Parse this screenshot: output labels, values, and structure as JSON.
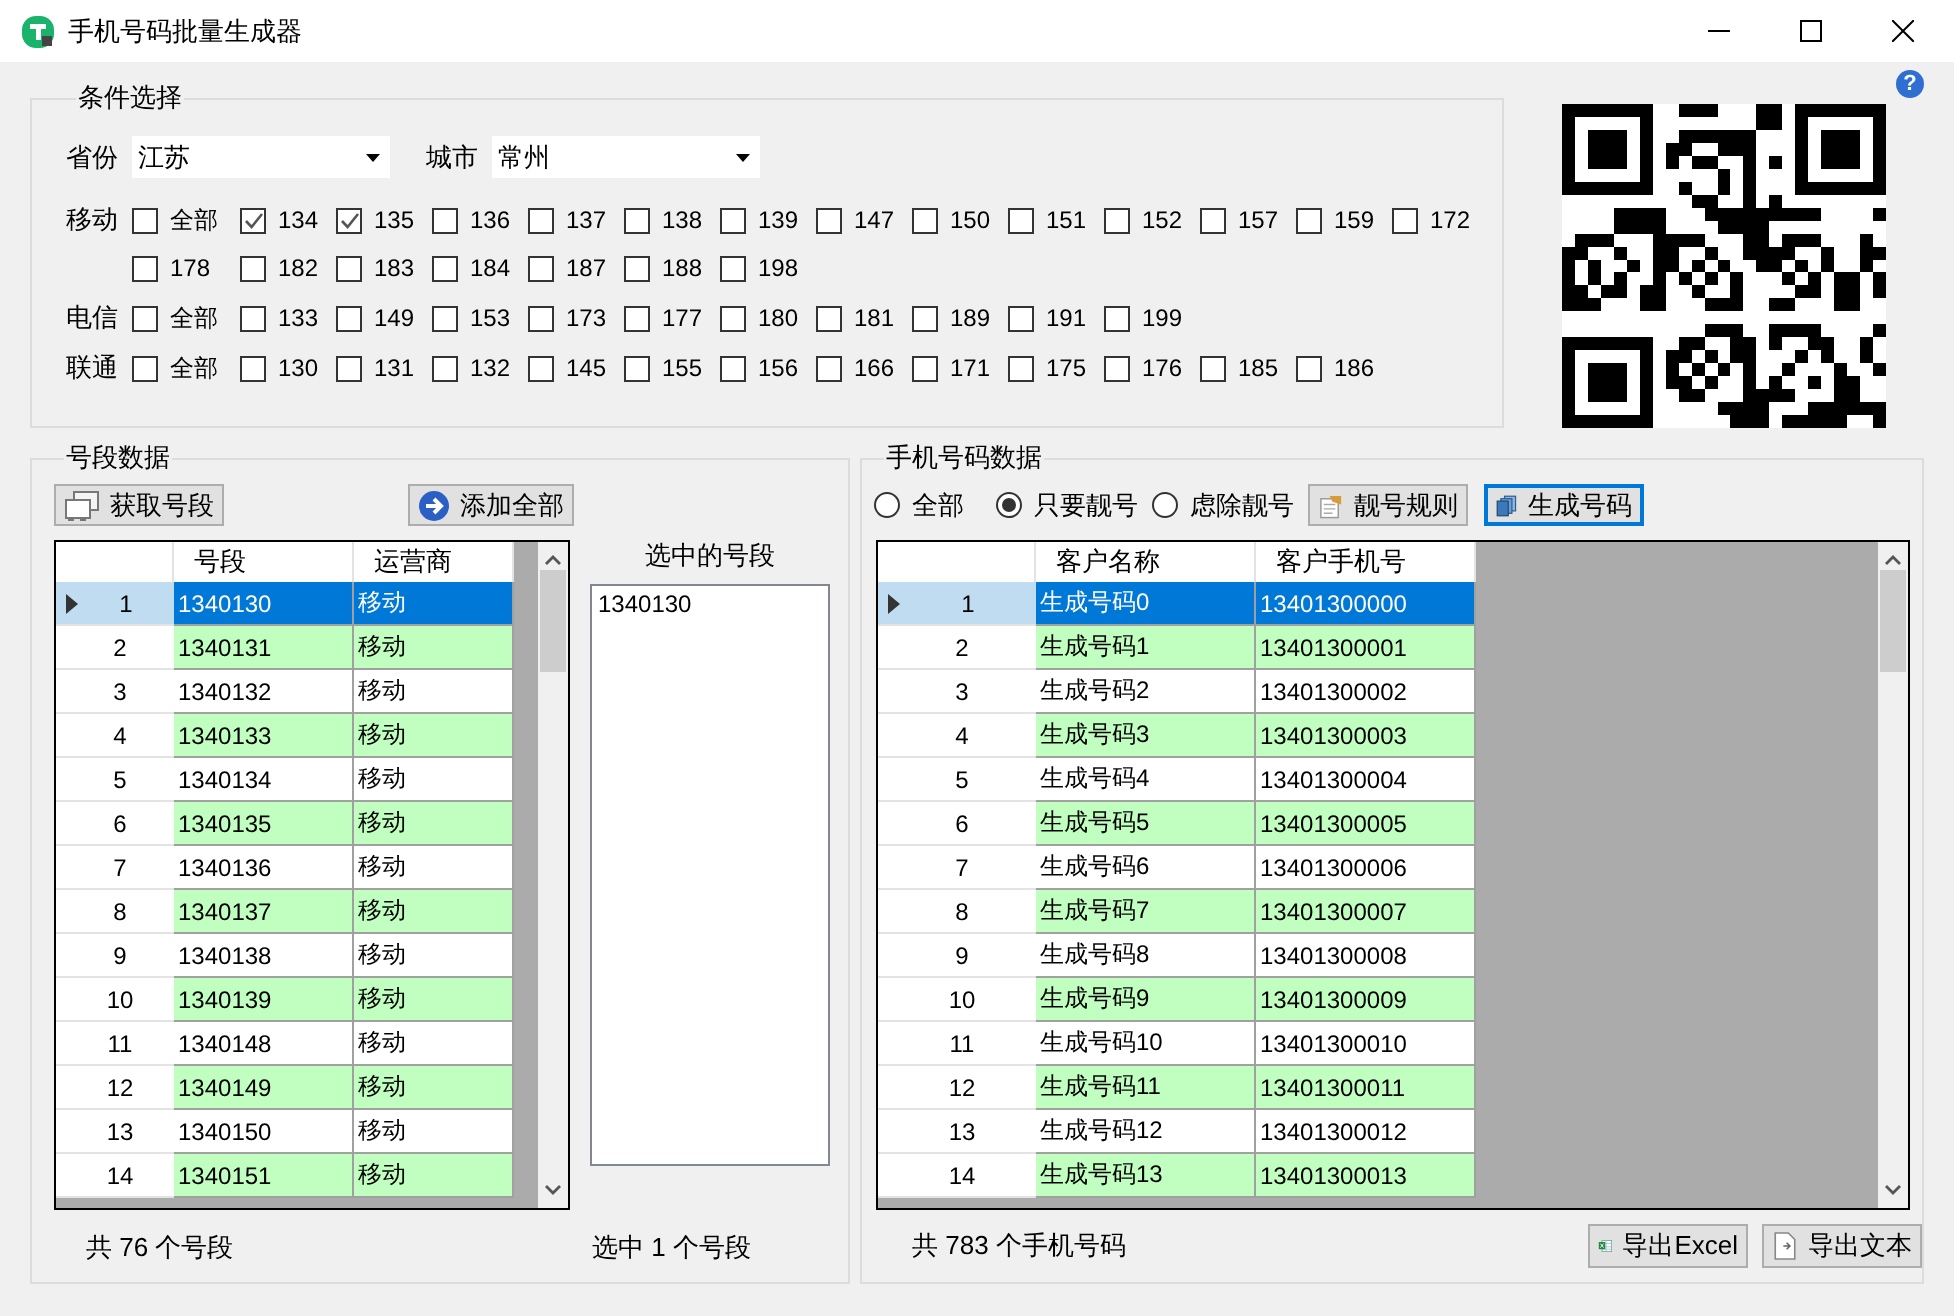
{
  "window": {
    "title": "手机号码批量生成器"
  },
  "help": {
    "label": "?"
  },
  "conditions": {
    "title": "条件选择",
    "province": {
      "label": "省份",
      "value": "江苏"
    },
    "city": {
      "label": "城市",
      "value": "常州"
    },
    "carriers": [
      {
        "name": "移动",
        "rows": [
          [
            {
              "label": "全部",
              "checked": false
            },
            {
              "label": "134",
              "checked": true
            },
            {
              "label": "135",
              "checked": true
            },
            {
              "label": "136",
              "checked": false
            },
            {
              "label": "137",
              "checked": false
            },
            {
              "label": "138",
              "checked": false
            },
            {
              "label": "139",
              "checked": false
            },
            {
              "label": "147",
              "checked": false
            },
            {
              "label": "150",
              "checked": false
            },
            {
              "label": "151",
              "checked": false
            },
            {
              "label": "152",
              "checked": false
            },
            {
              "label": "157",
              "checked": false
            },
            {
              "label": "159",
              "checked": false
            },
            {
              "label": "172",
              "checked": false
            }
          ],
          [
            {
              "label": "178",
              "checked": false
            },
            {
              "label": "182",
              "checked": false
            },
            {
              "label": "183",
              "checked": false
            },
            {
              "label": "184",
              "checked": false
            },
            {
              "label": "187",
              "checked": false
            },
            {
              "label": "188",
              "checked": false
            },
            {
              "label": "198",
              "checked": false
            }
          ]
        ]
      },
      {
        "name": "电信",
        "rows": [
          [
            {
              "label": "全部",
              "checked": false
            },
            {
              "label": "133",
              "checked": false
            },
            {
              "label": "149",
              "checked": false
            },
            {
              "label": "153",
              "checked": false
            },
            {
              "label": "173",
              "checked": false
            },
            {
              "label": "177",
              "checked": false
            },
            {
              "label": "180",
              "checked": false
            },
            {
              "label": "181",
              "checked": false
            },
            {
              "label": "189",
              "checked": false
            },
            {
              "label": "191",
              "checked": false
            },
            {
              "label": "199",
              "checked": false
            }
          ]
        ]
      },
      {
        "name": "联通",
        "rows": [
          [
            {
              "label": "全部",
              "checked": false
            },
            {
              "label": "130",
              "checked": false
            },
            {
              "label": "131",
              "checked": false
            },
            {
              "label": "132",
              "checked": false
            },
            {
              "label": "145",
              "checked": false
            },
            {
              "label": "155",
              "checked": false
            },
            {
              "label": "156",
              "checked": false
            },
            {
              "label": "166",
              "checked": false
            },
            {
              "label": "171",
              "checked": false
            },
            {
              "label": "175",
              "checked": false
            },
            {
              "label": "176",
              "checked": false
            },
            {
              "label": "185",
              "checked": false
            },
            {
              "label": "186",
              "checked": false
            }
          ]
        ]
      }
    ]
  },
  "ranges": {
    "title": "号段数据",
    "buttons": [
      {
        "label": "获取号段",
        "kind": "fetch"
      },
      {
        "label": "添加全部",
        "kind": "add"
      }
    ],
    "table": {
      "columns": [
        "号段",
        "运营商"
      ],
      "rows": [
        {
          "no": "1",
          "cells": [
            "1340130",
            "移动"
          ],
          "selected": true
        },
        {
          "no": "2",
          "cells": [
            "1340131",
            "移动"
          ],
          "selected": false
        },
        {
          "no": "3",
          "cells": [
            "1340132",
            "移动"
          ],
          "selected": false
        },
        {
          "no": "4",
          "cells": [
            "1340133",
            "移动"
          ],
          "selected": false
        },
        {
          "no": "5",
          "cells": [
            "1340134",
            "移动"
          ],
          "selected": false
        },
        {
          "no": "6",
          "cells": [
            "1340135",
            "移动"
          ],
          "selected": false
        },
        {
          "no": "7",
          "cells": [
            "1340136",
            "移动"
          ],
          "selected": false
        },
        {
          "no": "8",
          "cells": [
            "1340137",
            "移动"
          ],
          "selected": false
        },
        {
          "no": "9",
          "cells": [
            "1340138",
            "移动"
          ],
          "selected": false
        },
        {
          "no": "10",
          "cells": [
            "1340139",
            "移动"
          ],
          "selected": false
        },
        {
          "no": "11",
          "cells": [
            "1340148",
            "移动"
          ],
          "selected": false
        },
        {
          "no": "12",
          "cells": [
            "1340149",
            "移动"
          ],
          "selected": false
        },
        {
          "no": "13",
          "cells": [
            "1340150",
            "移动"
          ],
          "selected": false
        },
        {
          "no": "14",
          "cells": [
            "1340151",
            "移动"
          ],
          "selected": false
        }
      ]
    },
    "selected_title": "选中的号段",
    "selected_list": [
      "1340130"
    ],
    "total": "共 76 个号段",
    "selected_count": "选中 1 个号段"
  },
  "numbers": {
    "title": "手机号码数据",
    "filters": [
      {
        "label": "全部",
        "selected": false
      },
      {
        "label": "只要靓号",
        "selected": true
      },
      {
        "label": "虑除靓号",
        "selected": false
      }
    ],
    "buttons": [
      {
        "label": "靓号规则",
        "kind": "rules",
        "focused": false
      },
      {
        "label": "生成号码",
        "kind": "generate",
        "focused": true
      }
    ],
    "table": {
      "columns": [
        "客户名称",
        "客户手机号"
      ],
      "rows": [
        {
          "no": "1",
          "cells": [
            "生成号码0",
            "13401300000"
          ],
          "selected": true
        },
        {
          "no": "2",
          "cells": [
            "生成号码1",
            "13401300001"
          ],
          "selected": false
        },
        {
          "no": "3",
          "cells": [
            "生成号码2",
            "13401300002"
          ],
          "selected": false
        },
        {
          "no": "4",
          "cells": [
            "生成号码3",
            "13401300003"
          ],
          "selected": false
        },
        {
          "no": "5",
          "cells": [
            "生成号码4",
            "13401300004"
          ],
          "selected": false
        },
        {
          "no": "6",
          "cells": [
            "生成号码5",
            "13401300005"
          ],
          "selected": false
        },
        {
          "no": "7",
          "cells": [
            "生成号码6",
            "13401300006"
          ],
          "selected": false
        },
        {
          "no": "8",
          "cells": [
            "生成号码7",
            "13401300007"
          ],
          "selected": false
        },
        {
          "no": "9",
          "cells": [
            "生成号码8",
            "13401300008"
          ],
          "selected": false
        },
        {
          "no": "10",
          "cells": [
            "生成号码9",
            "13401300009"
          ],
          "selected": false
        },
        {
          "no": "11",
          "cells": [
            "生成号码10",
            "13401300010"
          ],
          "selected": false
        },
        {
          "no": "12",
          "cells": [
            "生成号码11",
            "13401300011"
          ],
          "selected": false
        },
        {
          "no": "13",
          "cells": [
            "生成号码12",
            "13401300012"
          ],
          "selected": false
        },
        {
          "no": "14",
          "cells": [
            "生成号码13",
            "13401300013"
          ],
          "selected": false
        }
      ]
    },
    "total": "共 783 个手机号码",
    "export_buttons": [
      {
        "label": "导出Excel",
        "kind": "excel"
      },
      {
        "label": "导出文本",
        "kind": "text"
      }
    ]
  }
}
